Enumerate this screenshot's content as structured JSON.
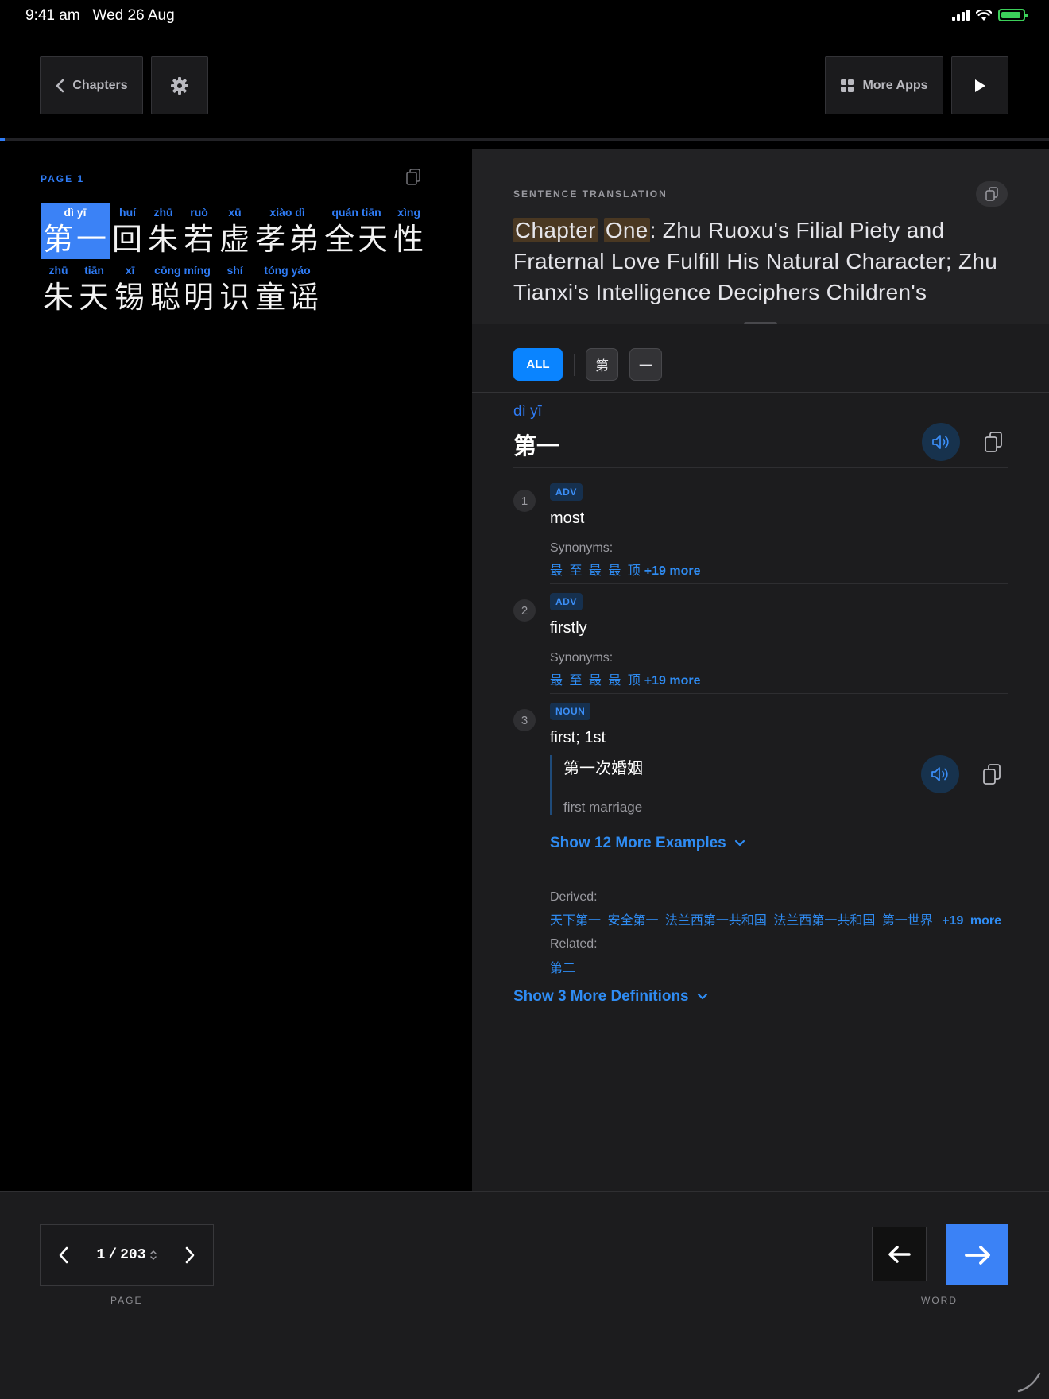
{
  "status": {
    "time": "9:41 am",
    "date": "Wed 26 Aug"
  },
  "toolbar": {
    "chapters_label": "Chapters",
    "more_apps_label": "More Apps"
  },
  "reader": {
    "page_label": "PAGE 1",
    "lines": [
      [
        {
          "py": "dì yī",
          "hz": "第一",
          "selected": true
        },
        {
          "py": "huí",
          "hz": "回"
        },
        {
          "py": "zhū",
          "hz": "朱"
        },
        {
          "py": "ruò",
          "hz": "若"
        },
        {
          "py": "xū",
          "hz": "虚"
        },
        {
          "py": "xiào dì",
          "hz": "孝弟"
        },
        {
          "py": "quán tiān",
          "hz": "全天"
        },
        {
          "py": "xìng",
          "hz": "性"
        }
      ],
      [
        {
          "py": "zhū",
          "hz": "朱"
        },
        {
          "py": "tiān",
          "hz": "天"
        },
        {
          "py": "xī",
          "hz": "锡"
        },
        {
          "py": "cōng míng",
          "hz": "聪明"
        },
        {
          "py": "shí",
          "hz": "识"
        },
        {
          "py": "tóng yáo",
          "hz": "童谣"
        }
      ]
    ]
  },
  "translation": {
    "label": "SENTENCE TRANSLATION",
    "hl1": "Chapter",
    "hl2": "One",
    "rest": ": Zhu Ruoxu's Filial Piety and Fraternal Love Fulfill His Natural Character; Zhu Tianxi's Intelligence Deciphers Children's"
  },
  "filters": {
    "all": "ALL",
    "chars": [
      "第",
      "一"
    ]
  },
  "entry": {
    "pinyin": "dì yī",
    "hanzi": "第一",
    "definitions": [
      {
        "num": "1",
        "pos": "ADV",
        "gloss": "most",
        "syn_label": "Synonyms:",
        "synonyms": "最 至 最 最 顶",
        "syn_more": "+19 more"
      },
      {
        "num": "2",
        "pos": "ADV",
        "gloss": "firstly",
        "syn_label": "Synonyms:",
        "synonyms": "最 至 最 最 顶",
        "syn_more": "+19 more"
      },
      {
        "num": "3",
        "pos": "NOUN",
        "gloss": "first; 1st"
      }
    ],
    "example": {
      "hz": "第一次婚姻",
      "en": "first marriage"
    },
    "show_examples": "Show 12 More Examples",
    "derived_label": "Derived:",
    "derived": "天下第一 安全第一 法兰西第一共和国 法兰西第一共和国 第一世界",
    "derived_more": "+19 more",
    "related_label": "Related:",
    "related": "第二",
    "show_definitions": "Show 3 More Definitions"
  },
  "bottom": {
    "page_current": "1",
    "page_sep": "/",
    "page_total": "203",
    "page_label": "PAGE",
    "word_label": "WORD"
  },
  "colors": {
    "accent": "#0a84ff",
    "selection": "#3b82f6",
    "highlight": "#4a3822",
    "panel": "#1c1c1e"
  }
}
